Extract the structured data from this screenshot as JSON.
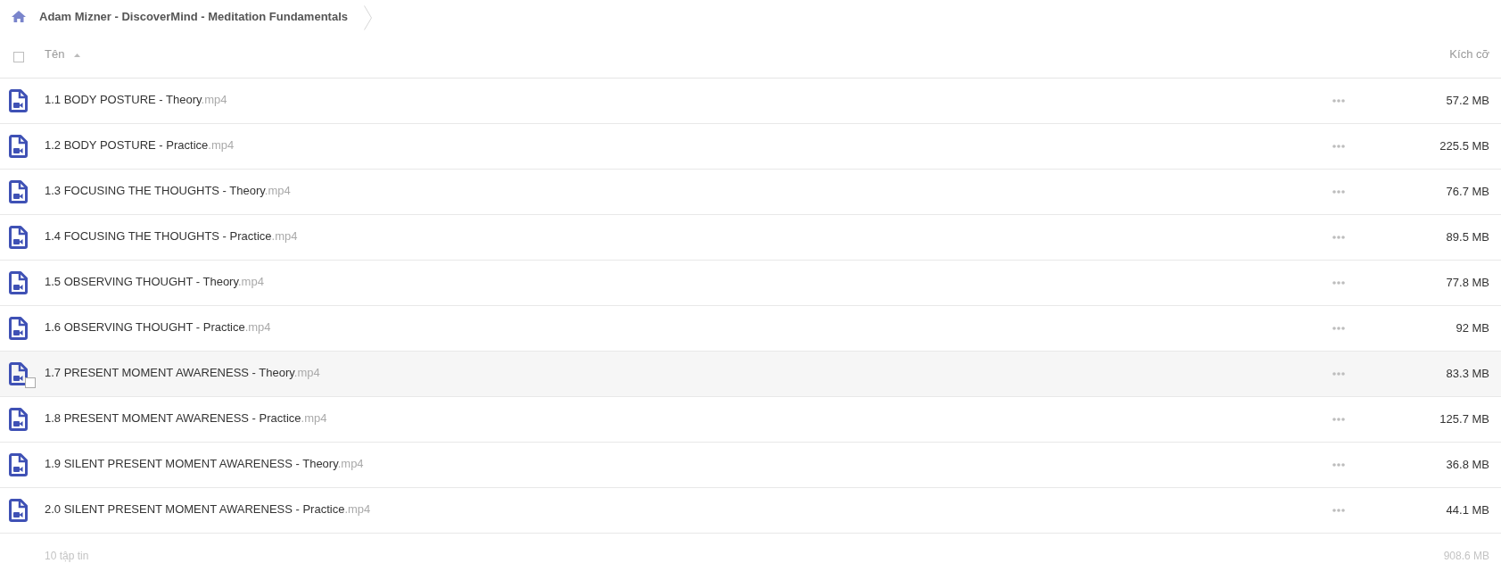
{
  "breadcrumb": {
    "path": "Adam Mizner - DiscoverMind - Meditation Fundamentals"
  },
  "table": {
    "select_all": {
      "checked": false
    },
    "columns": [
      {
        "label": "Tên",
        "sort_ascending": true
      },
      {
        "label": "Kích cỡ"
      }
    ],
    "rows": [
      {
        "name": "1.1 BODY POSTURE - Theory",
        "extension": ".mp4",
        "size": "57.2 MB",
        "hovered": false
      },
      {
        "name": "1.2 BODY POSTURE - Practice",
        "extension": ".mp4",
        "size": "225.5 MB",
        "hovered": false
      },
      {
        "name": "1.3 FOCUSING THE THOUGHTS - Theory",
        "extension": ".mp4",
        "size": "76.7 MB",
        "hovered": false
      },
      {
        "name": "1.4 FOCUSING THE THOUGHTS - Practice",
        "extension": ".mp4",
        "size": "89.5 MB",
        "hovered": false
      },
      {
        "name": "1.5 OBSERVING THOUGHT - Theory",
        "extension": ".mp4",
        "size": "77.8 MB",
        "hovered": false
      },
      {
        "name": "1.6 OBSERVING THOUGHT - Practice",
        "extension": ".mp4",
        "size": "92 MB",
        "hovered": false
      },
      {
        "name": "1.7 PRESENT MOMENT AWARENESS - Theory",
        "extension": ".mp4",
        "size": "83.3 MB",
        "hovered": true
      },
      {
        "name": "1.8 PRESENT MOMENT AWARENESS - Practice",
        "extension": ".mp4",
        "size": "125.7 MB",
        "hovered": false
      },
      {
        "name": "1.9 SILENT PRESENT MOMENT AWARENESS - Theory",
        "extension": ".mp4",
        "size": "36.8 MB",
        "hovered": false
      },
      {
        "name": "2.0 SILENT PRESENT MOMENT AWARENESS - Practice",
        "extension": ".mp4",
        "size": "44.1 MB",
        "hovered": false
      }
    ]
  },
  "footer": {
    "count": "10 tập tin",
    "total": "908.6 MB"
  }
}
